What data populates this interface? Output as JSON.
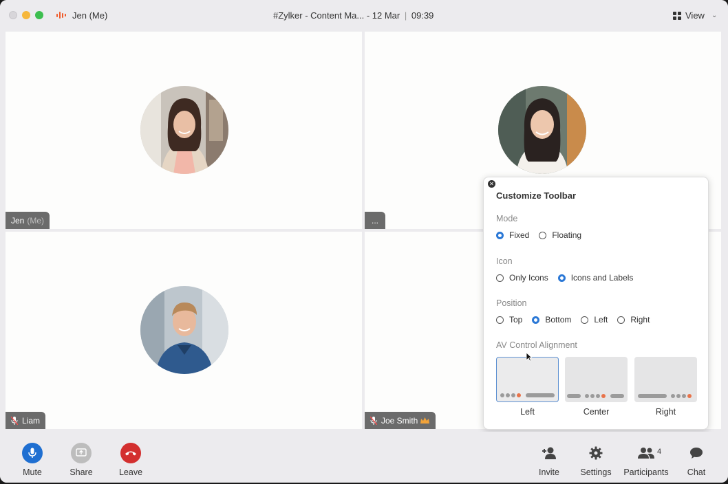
{
  "titlebar": {
    "user": "Jen (Me)",
    "meeting_title": "#Zylker - Content Ma... - 12 Mar",
    "time": "09:39",
    "view_label": "View"
  },
  "tiles": [
    {
      "name": "Jen",
      "suffix": "(Me)",
      "muted": false
    },
    {
      "name": "...",
      "suffix": "",
      "muted": false
    },
    {
      "name": "Liam",
      "suffix": "",
      "muted": true
    },
    {
      "name": "Joe Smith",
      "suffix": "",
      "muted": true,
      "host": true
    }
  ],
  "customize": {
    "title": "Customize Toolbar",
    "mode": {
      "label": "Mode",
      "options": [
        "Fixed",
        "Floating"
      ],
      "selected": "Fixed"
    },
    "icon": {
      "label": "Icon",
      "options": [
        "Only Icons",
        "Icons and Labels"
      ],
      "selected": "Icons and Labels"
    },
    "position": {
      "label": "Position",
      "options": [
        "Top",
        "Bottom",
        "Left",
        "Right"
      ],
      "selected": "Bottom"
    },
    "alignment": {
      "label": "AV Control Alignment",
      "options": [
        "Left",
        "Center",
        "Right"
      ],
      "selected": "Left"
    }
  },
  "toolbar": {
    "mute": "Mute",
    "share": "Share",
    "leave": "Leave",
    "invite": "Invite",
    "settings": "Settings",
    "participants": "Participants",
    "participants_count": "4",
    "chat": "Chat"
  },
  "colors": {
    "accent": "#2b78d6",
    "mute_button": "#1f6fd1",
    "leave_button": "#d32f2f",
    "share_button": "#bdbdbd",
    "brand_wave": "#f05a29"
  }
}
